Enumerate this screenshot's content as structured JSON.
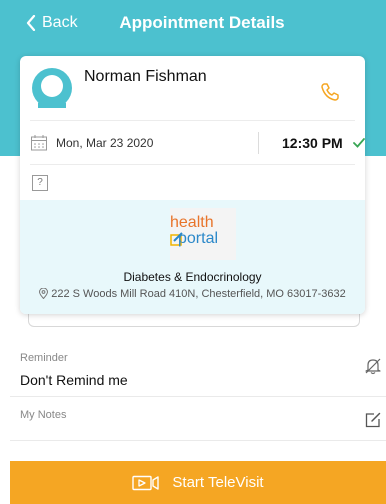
{
  "header": {
    "back_label": "Back",
    "title": "Appointment Details"
  },
  "appointment": {
    "patient_name": "Norman Fishman",
    "date": "Mon, Mar 23  2020",
    "time": "12:30 PM",
    "unknown_badge": "?"
  },
  "provider": {
    "logo_text_top": "health",
    "logo_text_bottom": "portal",
    "specialty": "Diabetes & Endocrinology",
    "address": "222 S Woods Mill Road 410N, Chesterfield, MO 63017-3632"
  },
  "reminder": {
    "label": "Reminder",
    "value": "Don't Remind me"
  },
  "notes": {
    "label": "My Notes"
  },
  "footer": {
    "televisit_label": "Start TeleVisit"
  },
  "colors": {
    "primary": "#4cc1cf",
    "accent": "#f5a623",
    "check": "#3aa655"
  },
  "icons": [
    "chevron-left-icon",
    "avatar-icon",
    "phone-icon",
    "calendar-icon",
    "check-icon",
    "location-pin-icon",
    "bell-off-icon",
    "edit-note-icon",
    "video-icon"
  ]
}
